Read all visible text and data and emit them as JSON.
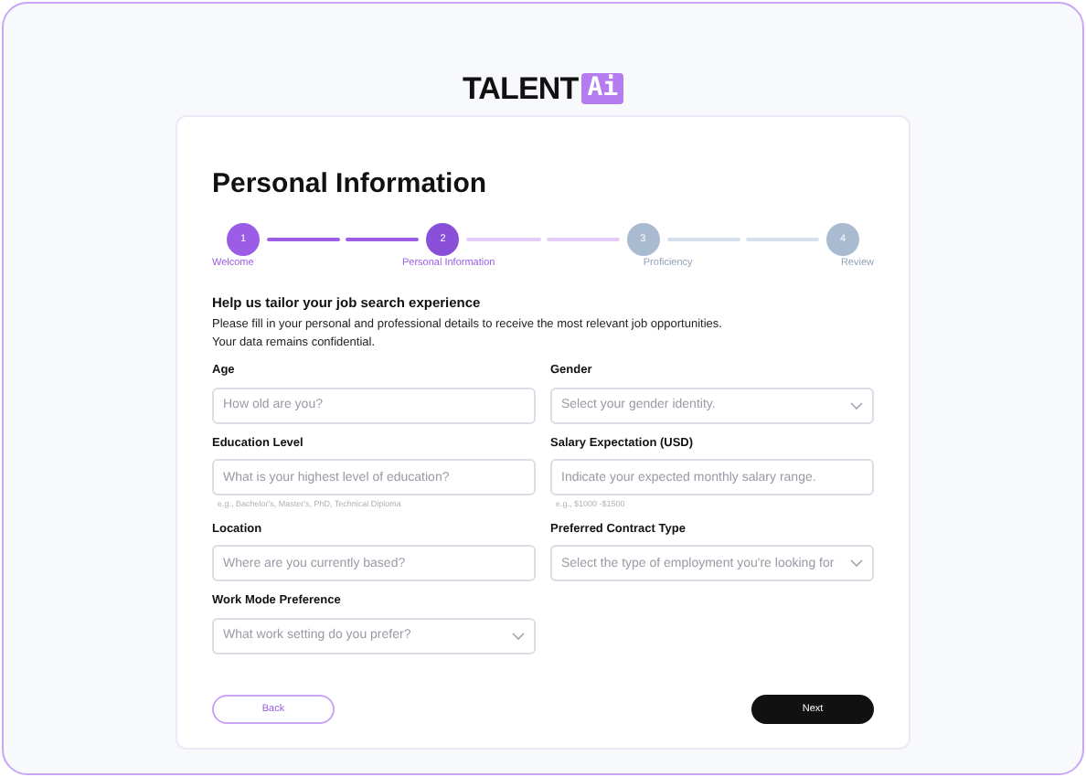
{
  "logo": {
    "word": "TALENT",
    "badge": "Ai"
  },
  "title": "Personal Information",
  "steps": [
    {
      "number": "1",
      "label": "Welcome",
      "done": true,
      "active": false
    },
    {
      "number": "2",
      "label": "Personal Information",
      "done": false,
      "active": true
    },
    {
      "number": "3",
      "label": "Proficiency",
      "done": false,
      "active": false
    },
    {
      "number": "4",
      "label": "Review",
      "done": false,
      "active": false
    }
  ],
  "heading": "Help us tailor your job search experience",
  "intro": [
    "Please fill in your personal and professional details to receive the most relevant job opportunities.",
    "Your data remains confidential."
  ],
  "fields": [
    {
      "label": "Age",
      "kind": "text",
      "placeholder": "How old are you?"
    },
    {
      "label": "Gender",
      "kind": "select",
      "placeholder": "Select your gender identity."
    },
    {
      "label": "Education Level",
      "kind": "text",
      "placeholder": "What is your highest level of education?",
      "hint": "e.g., Bachelor's, Master's, PhD, Technical Diploma"
    },
    {
      "label": "Salary Expectation (USD)",
      "kind": "text",
      "placeholder": "Indicate your expected monthly salary range.",
      "hint": "e.g., $1000 -$1500"
    },
    {
      "label": "Location",
      "kind": "text",
      "placeholder": "Where are you currently based?"
    },
    {
      "label": "Preferred Contract Type",
      "kind": "select",
      "placeholder": "Select the type of employment you're looking for"
    },
    {
      "label": "Work Mode Preference",
      "kind": "select",
      "placeholder": "What work setting do you prefer?"
    }
  ],
  "buttons": {
    "back": "Back",
    "next": "Next"
  }
}
